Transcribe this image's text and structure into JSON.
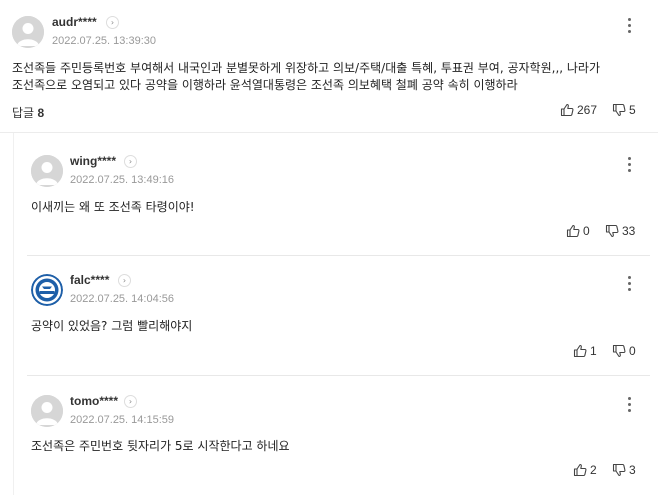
{
  "comments": [
    {
      "nick": "audr****",
      "date": "2022.07.25. 13:39:30",
      "text_line1": "조선족들 주민등록번호 부여해서 내국인과 분별못하게 위장하고 의보/주택/대출 특혜, 투표권 부여, 공자학원,,, 나라가",
      "text_line2": "조선족으로 오염되고 있다 공약을 이행하라 윤석열대통령은 조선족 의보혜택 철폐 공약 속히 이행하라",
      "reply_label": "답글",
      "reply_count": "8",
      "likes": "267",
      "dislikes": "5",
      "avatar_icon": "default-user-icon"
    }
  ],
  "replies": [
    {
      "nick": "wing****",
      "date": "2022.07.25. 13:49:16",
      "text": "이새끼는 왜 또 조선족 타령이야!",
      "likes": "0",
      "dislikes": "33",
      "avatar_icon": "default-user-icon"
    },
    {
      "nick": "falc****",
      "date": "2022.07.25. 14:04:56",
      "text": "공약이 있었음? 그럼 빨리해야지",
      "likes": "1",
      "dislikes": "0",
      "avatar_icon": "blue-emblem-avatar-icon"
    },
    {
      "nick": "tomo****",
      "date": "2022.07.25. 14:15:59",
      "text": "조선족은 주민번호 뒷자리가 5로 시작한다고 하네요",
      "likes": "2",
      "dislikes": "3",
      "avatar_icon": "default-user-icon"
    }
  ],
  "colors": {
    "nick": "#333333",
    "date": "#999999",
    "divider": "#e8e8e8",
    "emblem": "#1e5fa8"
  }
}
